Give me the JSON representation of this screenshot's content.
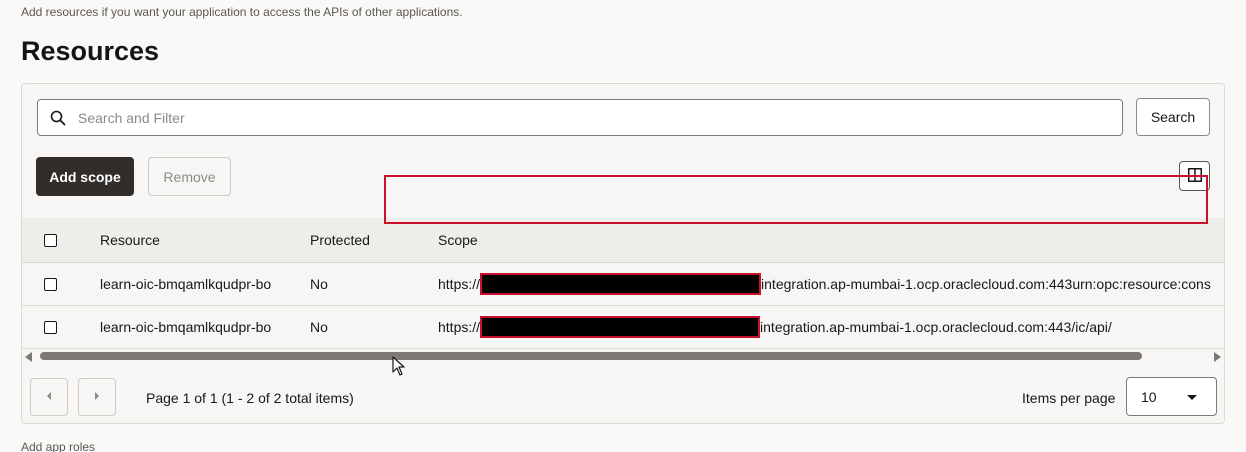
{
  "intro": "Add resources if you want your application to access the APIs of other applications.",
  "title": "Resources",
  "search": {
    "placeholder": "Search and Filter",
    "button": "Search",
    "icon": "search-icon"
  },
  "toolbar": {
    "add_label": "Add scope",
    "remove_label": "Remove",
    "columns_icon": "columns-icon"
  },
  "table": {
    "columns": [
      "Resource",
      "Protected",
      "Scope"
    ],
    "rows": [
      {
        "resource": "learn-oic-bmqamlkqudpr-bo",
        "protected": "No",
        "scope_prefix": "https://",
        "scope_suffix": "integration.ap-mumbai-1.ocp.oraclecloud.com:443urn:opc:resource:cons"
      },
      {
        "resource": "learn-oic-bmqamlkqudpr-bo",
        "protected": "No",
        "scope_prefix": "https://",
        "scope_suffix": "integration.ap-mumbai-1.ocp.oraclecloud.com:443/ic/api/"
      }
    ]
  },
  "pagination": {
    "info": "Page 1 of 1 (1 - 2 of 2 total items)",
    "items_per_page_label": "Items per page",
    "items_per_page_value": "10"
  },
  "footer": "Add app roles",
  "colors": {
    "accent_dark": "#312d2a",
    "highlight": "#c8102e",
    "redaction": "#000000"
  }
}
